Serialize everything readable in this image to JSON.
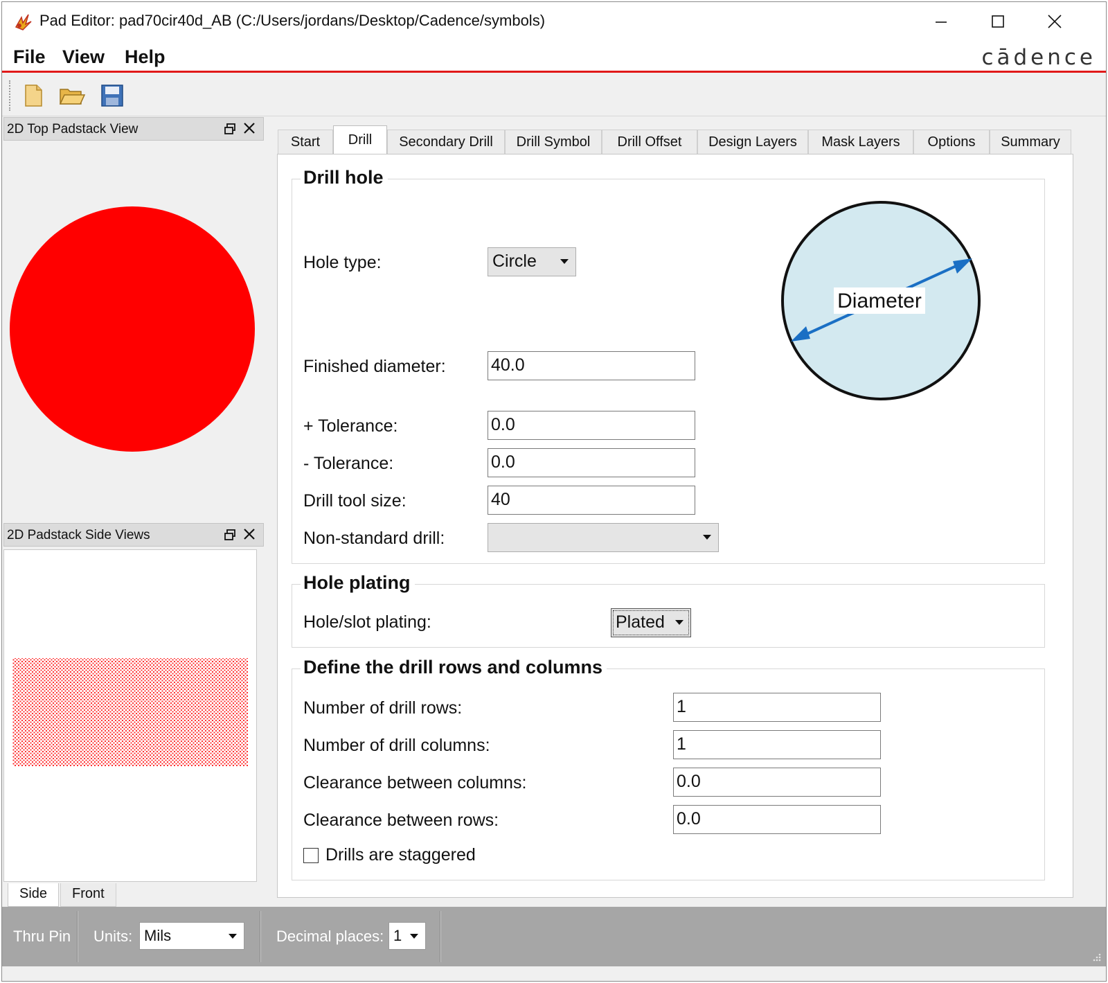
{
  "window": {
    "title": "Pad Editor: pad70cir40d_AB  (C:/Users/jordans/Desktop/Cadence/symbols)",
    "controls": {
      "minimize": "minimize-icon",
      "maximize": "maximize-icon",
      "close": "close-icon"
    }
  },
  "menu": {
    "items": [
      "File",
      "View",
      "Help"
    ],
    "logo": "cādence"
  },
  "toolbar": {
    "buttons": [
      "new-file-icon",
      "open-folder-icon",
      "save-icon"
    ]
  },
  "docks": {
    "top_view": {
      "title": "2D Top Padstack View"
    },
    "side_view": {
      "title": "2D Padstack Side Views",
      "tabs": [
        "Side",
        "Front"
      ]
    }
  },
  "tabs": {
    "items": [
      "Start",
      "Drill",
      "Secondary Drill",
      "Drill Symbol",
      "Drill Offset",
      "Design Layers",
      "Mask Layers",
      "Options",
      "Summary"
    ],
    "active": "Drill"
  },
  "drill_hole": {
    "title": "Drill hole",
    "hole_type_label": "Hole type:",
    "hole_type_value": "Circle",
    "diagram_label": "Diameter",
    "finished_diameter_label": "Finished diameter:",
    "finished_diameter_value": "40.0",
    "plus_tolerance_label": "+ Tolerance:",
    "plus_tolerance_value": "0.0",
    "minus_tolerance_label": "- Tolerance:",
    "minus_tolerance_value": "0.0",
    "drill_tool_size_label": "Drill tool size:",
    "drill_tool_size_value": "40",
    "non_standard_drill_label": "Non-standard drill:",
    "non_standard_drill_value": ""
  },
  "hole_plating": {
    "title": "Hole plating",
    "label": "Hole/slot plating:",
    "value": "Plated"
  },
  "drill_rows_columns": {
    "title": "Define the drill rows and columns",
    "rows_label": "Number of drill rows:",
    "rows_value": "1",
    "columns_label": "Number of drill columns:",
    "columns_value": "1",
    "clearance_columns_label": "Clearance between columns:",
    "clearance_columns_value": "0.0",
    "clearance_rows_label": "Clearance between rows:",
    "clearance_rows_value": "0.0",
    "staggered_label": "Drills are staggered",
    "staggered_checked": false
  },
  "statusbar": {
    "pin_type": "Thru Pin",
    "units_label": "Units:",
    "units_value": "Mils",
    "decimal_label": "Decimal places:",
    "decimal_value": "1"
  },
  "colors": {
    "accent_red": "#e11919",
    "pad_red": "#ff0000",
    "diagram_fill": "#d3e9f0",
    "diagram_arrow": "#1a6fc4"
  }
}
